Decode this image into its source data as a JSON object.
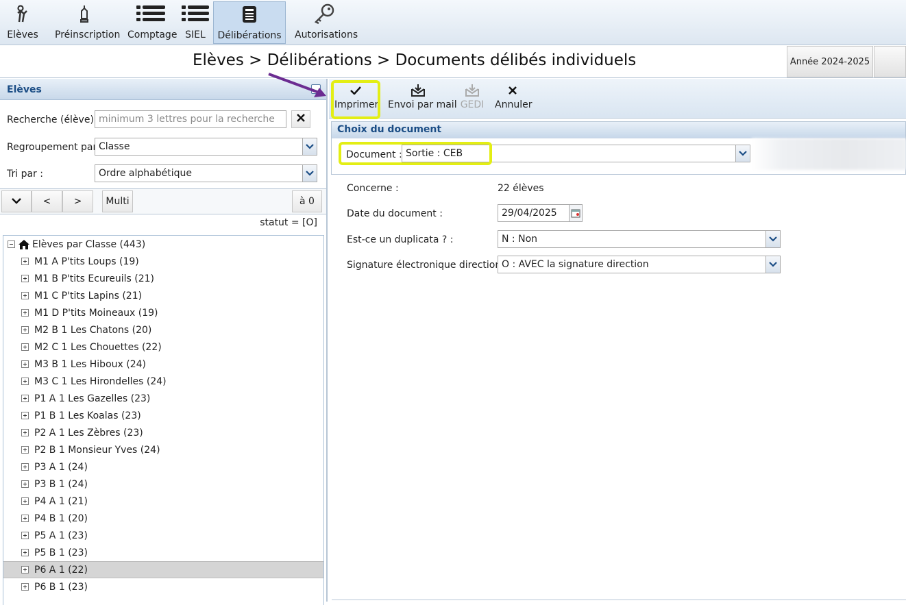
{
  "topbar": {
    "items": [
      {
        "label": "Elèves",
        "icon": "student-icon"
      },
      {
        "label": "Préinscription",
        "icon": "pen-icon"
      },
      {
        "label": "Comptage",
        "icon": "list-icon"
      },
      {
        "label": "SIEL",
        "icon": "list-icon"
      },
      {
        "label": "Délibérations",
        "icon": "document-icon",
        "active": true
      },
      {
        "label": "Autorisations",
        "icon": "key-icon"
      }
    ]
  },
  "header": {
    "title": "Elèves > Délibérations > Documents délibés individuels",
    "year": "Année 2024-2025"
  },
  "left": {
    "panel_title": "Elèves",
    "search_label": "Recherche (élève) :",
    "search_placeholder": "minimum 3 lettres pour la recherche",
    "group_label": "Regroupement par :",
    "group_value": "Classe",
    "sort_label": "Tri par :",
    "sort_value": "Ordre alphabétique",
    "prev_label": "<",
    "next_label": ">",
    "multi_label": "Multi",
    "zero_label": "à 0",
    "status_text": "statut = [O]",
    "tree_root": "Elèves par Classe (443)",
    "tree_items": [
      "M1 A P'tits Loups (19)",
      "M1 B P'tits Ecureuils (21)",
      "M1 C P'tits Lapins (21)",
      "M1 D P'tits Moineaux (19)",
      "M2 B 1 Les Chatons (20)",
      "M2 C 1 Les Chouettes (22)",
      "M3 B 1 Les Hiboux (24)",
      "M3 C 1 Les Hirondelles (24)",
      "P1 A 1 Les Gazelles (23)",
      "P1 B 1 Les Koalas (23)",
      "P2 A 1 Les Zèbres (23)",
      "P2 B 1 Monsieur Yves (24)",
      "P3 A 1 (24)",
      "P3 B 1 (24)",
      "P4 A 1 (21)",
      "P4 B 1 (20)",
      "P5 A 1 (23)",
      "P5 B 1 (23)",
      "P6 A 1 (22)",
      "P6 B 1 (23)"
    ],
    "selected_item": "P6 A 1 (22)"
  },
  "actions": {
    "print": "Imprimer",
    "mail": "Envoi par mail",
    "gedi": "GEDI",
    "cancel": "Annuler"
  },
  "document": {
    "section_title": "Choix du document",
    "doc_label": "Document :",
    "doc_value": "Sortie : CEB",
    "concerne_label": "Concerne :",
    "concerne_value": "22 élèves",
    "date_label": "Date du document :",
    "date_value": "29/04/2025",
    "duplicata_label": "Est-ce un duplicata ? :",
    "duplicata_value": "N : Non",
    "signature_label": "Signature électronique direction :",
    "signature_value": "O : AVEC la signature direction"
  },
  "colors": {
    "highlight": "#e3ee14",
    "arrow": "#6b2c91",
    "panel_title": "#1b4d85"
  }
}
